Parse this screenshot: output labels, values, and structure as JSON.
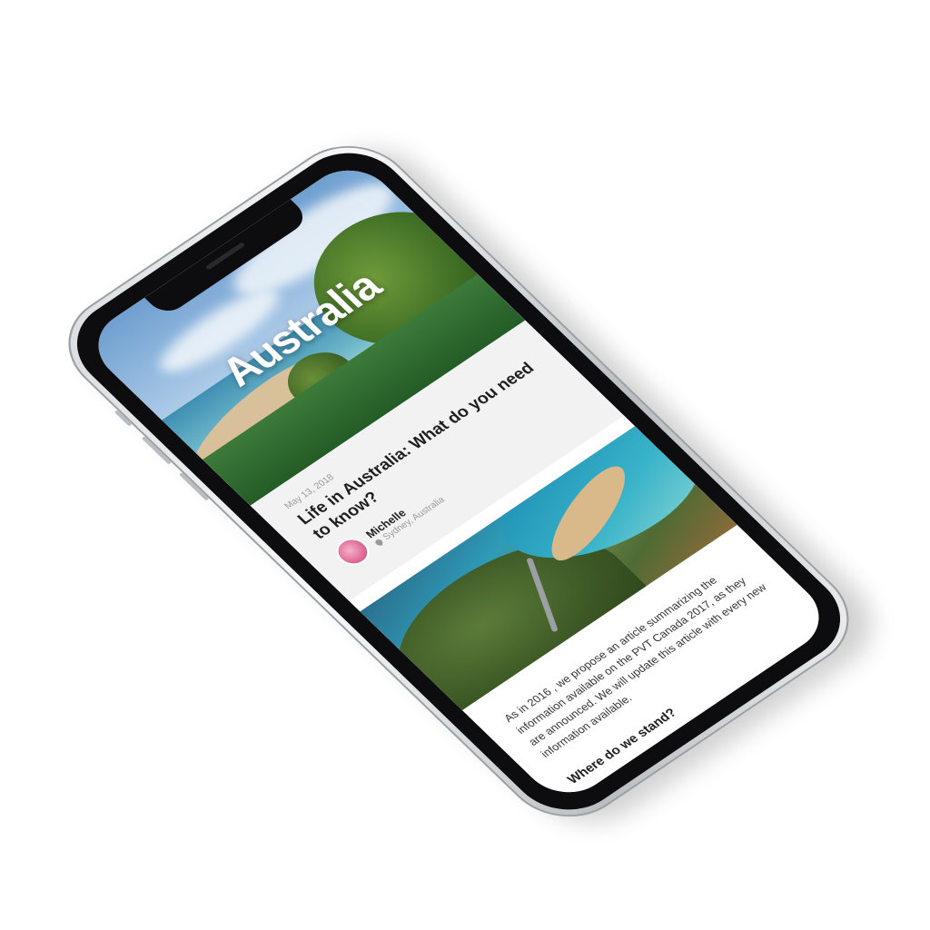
{
  "hero": {
    "title": "Australia"
  },
  "article": {
    "date": "May 13, 2018",
    "title": "Life in Australia: What do you need to know?",
    "author": {
      "name": "Michelle",
      "location": "Sydney, Australia"
    },
    "body": "As in 2016 , we propose an article summarizing the information available on the PVT Canada 2017, as they are announced. We will update this article with every new information available.",
    "subheading": "Where do we stand?"
  },
  "icons": {
    "location": "map-pin-icon",
    "avatar": "user-avatar"
  },
  "colors": {
    "header_background": "#f2f2f2",
    "text_dark": "#1e1e1e",
    "text_muted": "#9a9a9a",
    "hero_title": "#ffffff"
  }
}
